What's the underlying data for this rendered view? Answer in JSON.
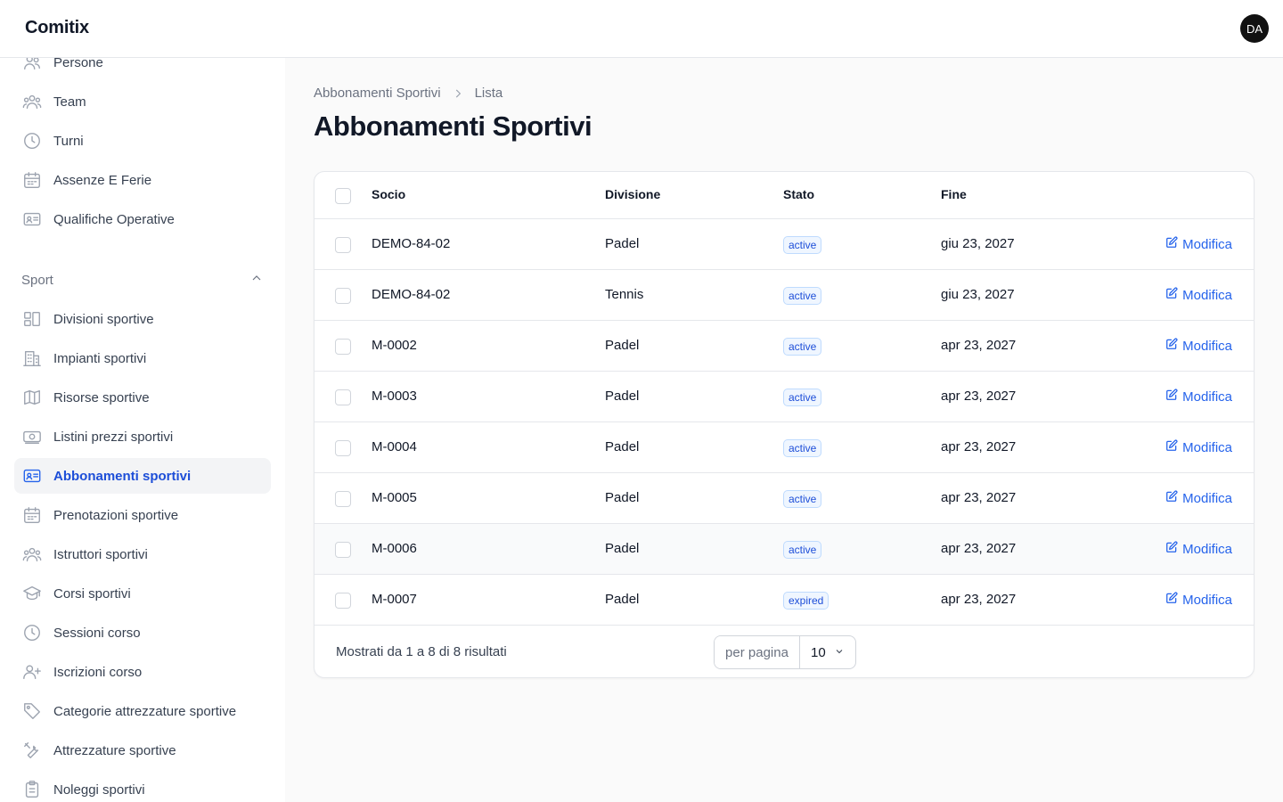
{
  "app": {
    "brand": "Comitix",
    "avatar_initials": "DA"
  },
  "sidebar": {
    "items_top": [
      {
        "label": "Persone",
        "icon": "users-icon"
      },
      {
        "label": "Team",
        "icon": "user-group-icon"
      },
      {
        "label": "Turni",
        "icon": "clock-icon"
      },
      {
        "label": "Assenze E Ferie",
        "icon": "calendar-icon"
      },
      {
        "label": "Qualifiche Operative",
        "icon": "id-card-icon"
      }
    ],
    "group": {
      "label": "Sport",
      "expanded": true
    },
    "items_sport": [
      {
        "label": "Divisioni sportive",
        "icon": "blocks-icon"
      },
      {
        "label": "Impianti sportivi",
        "icon": "building-icon"
      },
      {
        "label": "Risorse sportive",
        "icon": "map-icon"
      },
      {
        "label": "Listini prezzi sportivi",
        "icon": "banknote-icon"
      },
      {
        "label": "Abbonamenti sportivi",
        "icon": "id-card-icon",
        "active": true
      },
      {
        "label": "Prenotazioni sportive",
        "icon": "calendar-icon"
      },
      {
        "label": "Istruttori sportivi",
        "icon": "user-group-icon"
      },
      {
        "label": "Corsi sportivi",
        "icon": "academic-cap-icon"
      },
      {
        "label": "Sessioni corso",
        "icon": "clock-icon"
      },
      {
        "label": "Iscrizioni corso",
        "icon": "user-plus-icon"
      },
      {
        "label": "Categorie attrezzature sportive",
        "icon": "tag-icon"
      },
      {
        "label": "Attrezzature sportive",
        "icon": "wrench-icon"
      },
      {
        "label": "Noleggi sportivi",
        "icon": "clipboard-icon"
      }
    ]
  },
  "breadcrumb": {
    "parent": "Abbonamenti Sportivi",
    "current": "Lista"
  },
  "page": {
    "title": "Abbonamenti Sportivi"
  },
  "table": {
    "columns": {
      "socio": "Socio",
      "divisione": "Divisione",
      "stato": "Stato",
      "fine": "Fine"
    },
    "edit_label": "Modifica",
    "rows": [
      {
        "socio": "DEMO-84-02",
        "divisione": "Padel",
        "stato": "active",
        "fine": "giu 23, 2027"
      },
      {
        "socio": "DEMO-84-02",
        "divisione": "Tennis",
        "stato": "active",
        "fine": "giu 23, 2027"
      },
      {
        "socio": "M-0002",
        "divisione": "Padel",
        "stato": "active",
        "fine": "apr 23, 2027"
      },
      {
        "socio": "M-0003",
        "divisione": "Padel",
        "stato": "active",
        "fine": "apr 23, 2027"
      },
      {
        "socio": "M-0004",
        "divisione": "Padel",
        "stato": "active",
        "fine": "apr 23, 2027"
      },
      {
        "socio": "M-0005",
        "divisione": "Padel",
        "stato": "active",
        "fine": "apr 23, 2027"
      },
      {
        "socio": "M-0006",
        "divisione": "Padel",
        "stato": "active",
        "fine": "apr 23, 2027"
      },
      {
        "socio": "M-0007",
        "divisione": "Padel",
        "stato": "expired",
        "fine": "apr 23, 2027"
      }
    ]
  },
  "pagination": {
    "summary": "Mostrati da 1 a 8 di 8 risultati",
    "per_page_label": "per pagina",
    "per_page_value": "10"
  },
  "colors": {
    "accent": "#2563eb",
    "active_bg": "#f3f4f6"
  }
}
